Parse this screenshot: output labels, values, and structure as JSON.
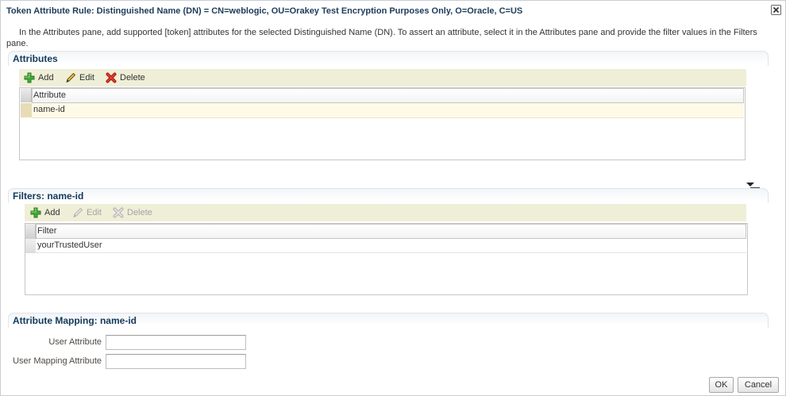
{
  "dialog": {
    "title": "Token Attribute Rule: Distinguished Name (DN) = CN=weblogic, OU=Orakey Test Encryption Purposes Only, O=Oracle, C=US",
    "instructions": "In the Attributes pane, add supported [token] attributes for the selected Distinguished Name (DN). To assert an attribute, select it in the Attributes pane and provide the filter values in the Filters pane."
  },
  "attributes": {
    "header": "Attributes",
    "toolbar": {
      "add": {
        "label": "Add",
        "icon": "plus-icon",
        "enabled": true
      },
      "edit": {
        "label": "Edit",
        "icon": "pencil-icon",
        "enabled": true
      },
      "delete": {
        "label": "Delete",
        "icon": "delete-x-icon",
        "enabled": true
      }
    },
    "columns": [
      "Attribute"
    ],
    "rows": [
      {
        "value": "name-id",
        "selected": true
      }
    ]
  },
  "filters": {
    "header": "Filters: name-id",
    "toolbar": {
      "add": {
        "label": "Add",
        "icon": "plus-icon",
        "enabled": true
      },
      "edit": {
        "label": "Edit",
        "icon": "pencil-icon",
        "enabled": false
      },
      "delete": {
        "label": "Delete",
        "icon": "delete-x-icon",
        "enabled": false
      }
    },
    "columns": [
      "Filter"
    ],
    "rows": [
      {
        "value": "yourTrustedUser",
        "selected": false
      }
    ]
  },
  "mapping": {
    "header": "Attribute Mapping: name-id",
    "fields": [
      {
        "label": "User Attribute",
        "value": ""
      },
      {
        "label": "User Mapping Attribute",
        "value": ""
      }
    ]
  },
  "buttons": {
    "ok": "OK",
    "cancel": "Cancel"
  },
  "icons": {
    "close": "close-icon",
    "splitter": "collapse-arrow-icon"
  },
  "colors": {
    "title": "#1e3b5a",
    "section_header": "#133a5c",
    "toolbar_background": "#efefd8",
    "selected_row": "#fdfae7",
    "selected_row_header": "#e6dcb6",
    "label": "#4f4a44",
    "disabled_text": "#a3a3a3"
  }
}
